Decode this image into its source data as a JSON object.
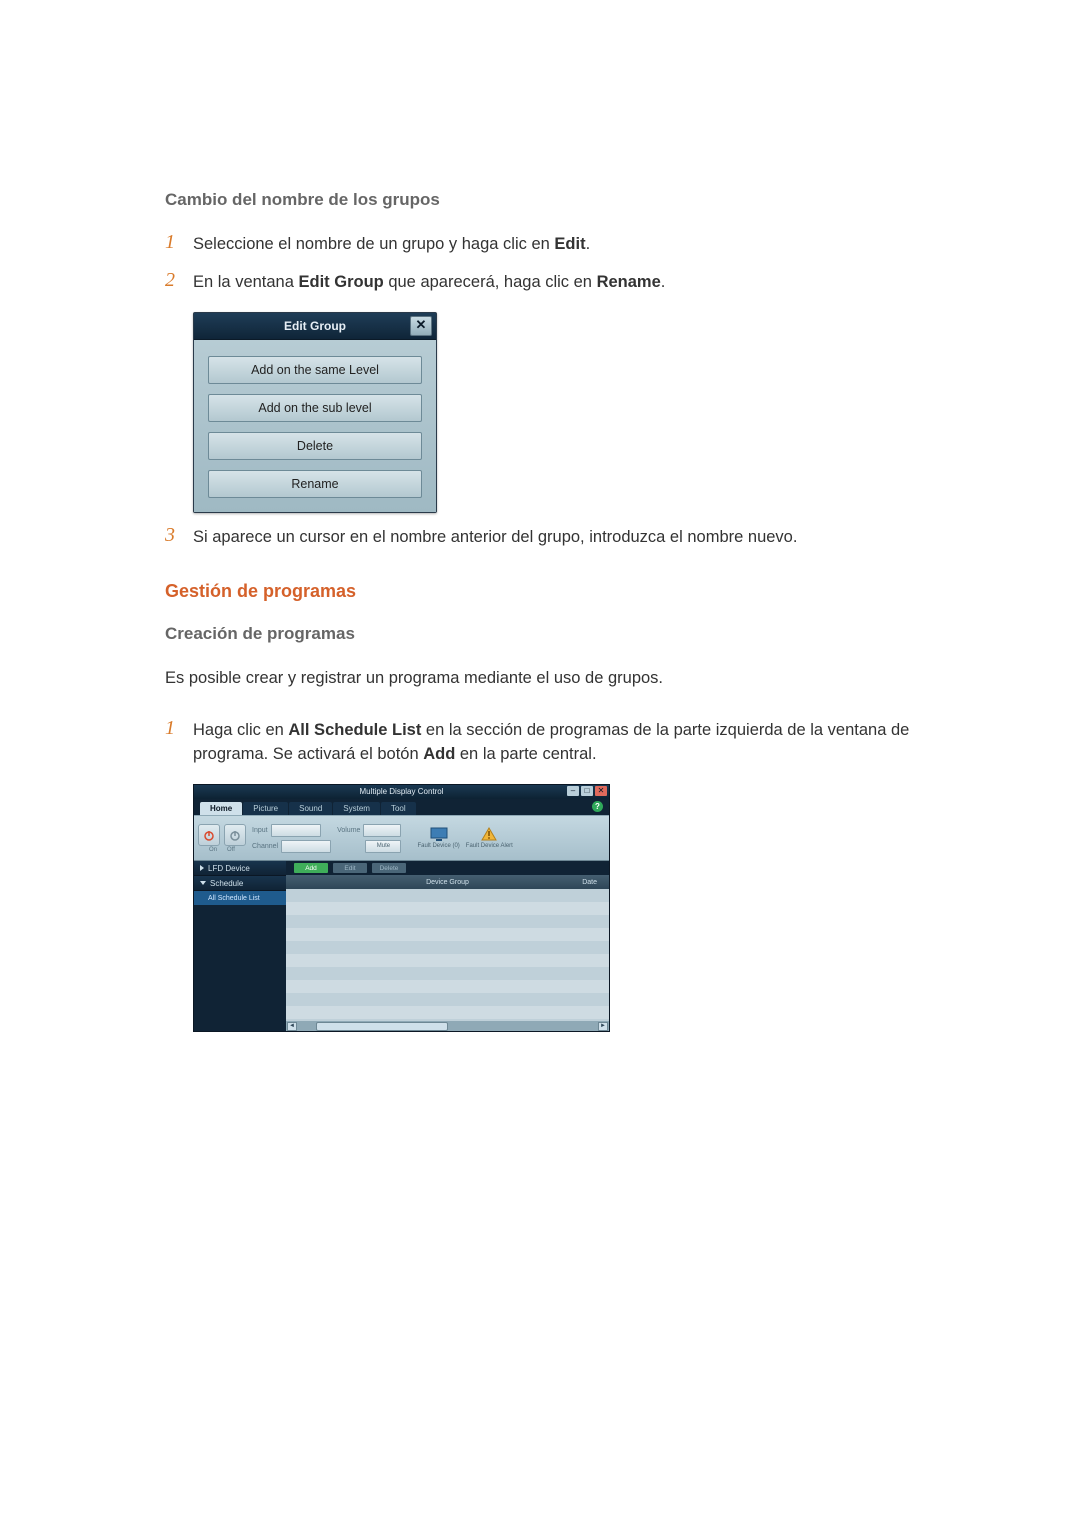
{
  "section1": {
    "heading": "Cambio del nombre de los grupos",
    "steps": {
      "s1_pre": "Seleccione el nombre de un grupo y haga clic en ",
      "s1_b": "Edit",
      "s1_post": ".",
      "s2_pre": "En la ventana ",
      "s2_b1": "Edit Group",
      "s2_mid": " que aparecerá, haga clic en ",
      "s2_b2": "Rename",
      "s2_post": ".",
      "s3": "Si aparece un cursor en el nombre anterior del grupo, introduzca el nombre nuevo."
    },
    "num1": "1",
    "num2": "2",
    "num3": "3"
  },
  "editGroupDialog": {
    "title": "Edit Group",
    "close": "✕",
    "btns": [
      "Add on the same Level",
      "Add on the sub level",
      "Delete",
      "Rename"
    ]
  },
  "section2": {
    "heading": "Gestión de programas",
    "subheading": "Creación de programas",
    "body": "Es posible crear y registrar un programa mediante el uso de grupos.",
    "num1": "1",
    "step1_pre": "Haga clic en ",
    "step1_b1": "All Schedule List",
    "step1_mid1": " en la sección de programas de la parte izquierda de la ventana de programa. Se activará el botón ",
    "step1_b2": "Add",
    "step1_mid2": " en la parte central."
  },
  "mdc": {
    "title": "Multiple Display Control",
    "win": {
      "min": "–",
      "max": "□",
      "close": "✕"
    },
    "tabs": [
      "Home",
      "Picture",
      "Sound",
      "System",
      "Tool"
    ],
    "help": "?",
    "ribbon": {
      "onLabel": "On",
      "offLabel": "Off",
      "inputLabel": "Input",
      "channelLabel": "Channel",
      "volumeLabel": "Volume",
      "muteLabel": "Mute",
      "fault0": "Fault Device (0)",
      "faultAlert": "Fault Device Alert"
    },
    "side": {
      "lfd": "LFD Device",
      "schedule": "Schedule",
      "allSchedule": "All Schedule List"
    },
    "toolbar": {
      "add": "Add",
      "edit": "Edit",
      "delete": "Delete"
    },
    "cols": {
      "group": "Device Group",
      "date": "Date"
    }
  }
}
